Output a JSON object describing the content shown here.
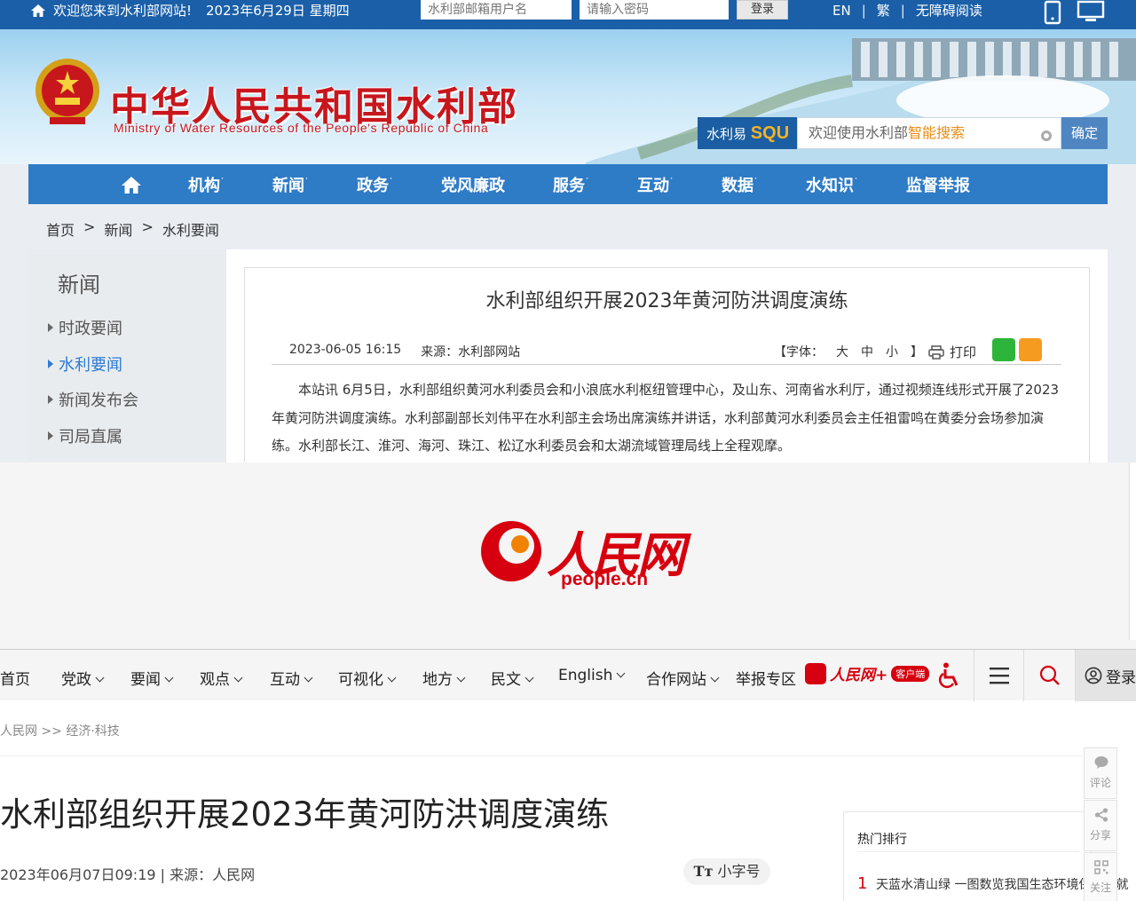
{
  "mwr": {
    "topbar": {
      "welcome": "欢迎您来到水利部网站!",
      "date": "2023年6月29日 星期四",
      "username_placeholder": "水利部邮箱用户名",
      "password_placeholder": "请输入密码",
      "login_label": "登录",
      "lang_en": "EN",
      "lang_trad": "繁",
      "accessible": "无障碍阅读",
      "separator": "|"
    },
    "banner": {
      "title": "中华人民共和国水利部",
      "subtitle": "Ministry of Water Resources of the People's Republic of China"
    },
    "search": {
      "brand_text": "水利易",
      "brand_mark": "SQU",
      "placeholder_prefix": "欢迎使用水利部",
      "placeholder_highlight": "智能搜索",
      "submit_label": "确定"
    },
    "nav": [
      "机构",
      "新闻",
      "政务",
      "党风廉政",
      "服务",
      "互动",
      "数据",
      "水知识",
      "监督举报"
    ],
    "nav_dropdown_marker": "˙",
    "breadcrumb": [
      "首页",
      "新闻",
      "水利要闻"
    ],
    "breadcrumb_sep": ">",
    "sidebar": {
      "heading": "新闻",
      "items": [
        "时政要闻",
        "水利要闻",
        "新闻发布会",
        "司局直属"
      ],
      "active": "水利要闻"
    },
    "article": {
      "title": "水利部组织开展2023年黄河防洪调度演练",
      "datetime": "2023-06-05 16:15",
      "source": "来源：水利部网站",
      "font_label": "【字体：",
      "font_large": "大",
      "font_medium": "中",
      "font_small": "小",
      "font_close": "】",
      "print_label": "打印",
      "body": "本站讯 6月5日，水利部组织黄河水利委员会和小浪底水利枢纽管理中心，及山东、河南省水利厅，通过视频连线形式开展了2023年黄河防洪调度演练。水利部副部长刘伟平在水利部主会场出席演练并讲话，水利部黄河水利委员会主任祖雷鸣在黄委分会场参加演练。水利部长江、淮河、海河、珠江、松辽水利委员会和太湖流域管理局线上全程观摩。"
    },
    "colors": {
      "topbar": "#1a5fa8",
      "nav": "#2e7bc6",
      "title_red": "#c8161d",
      "active_link": "#2d7bd3"
    }
  },
  "people": {
    "logo_text": "人民网",
    "logo_url": "people.cn",
    "nav": [
      "首页",
      "党政",
      "要闻",
      "观点",
      "互动",
      "可视化",
      "地方",
      "民文",
      "English",
      "合作网站",
      "举报专区"
    ],
    "plus_text": "人民网+",
    "plus_badge": "客户端",
    "login_label": "登录",
    "breadcrumb": "人民网 >> 经济·科技",
    "article": {
      "title": "水利部组织开展2023年黄河防洪调度演练",
      "datetime": "2023年06月07日09:19",
      "source_label": "来源：",
      "source": "人民网",
      "meta_sep": "|",
      "font_size_label": "小字号",
      "font_size_icon": "Tт"
    },
    "hot": {
      "heading": "热门排行",
      "items": [
        {
          "rank": "1",
          "title": "天蓝水清山绿 一图数览我国生态环境保护成就"
        }
      ]
    },
    "side_tools": [
      "评论",
      "分享",
      "关注"
    ],
    "colors": {
      "brand_red": "#d7000f"
    }
  }
}
